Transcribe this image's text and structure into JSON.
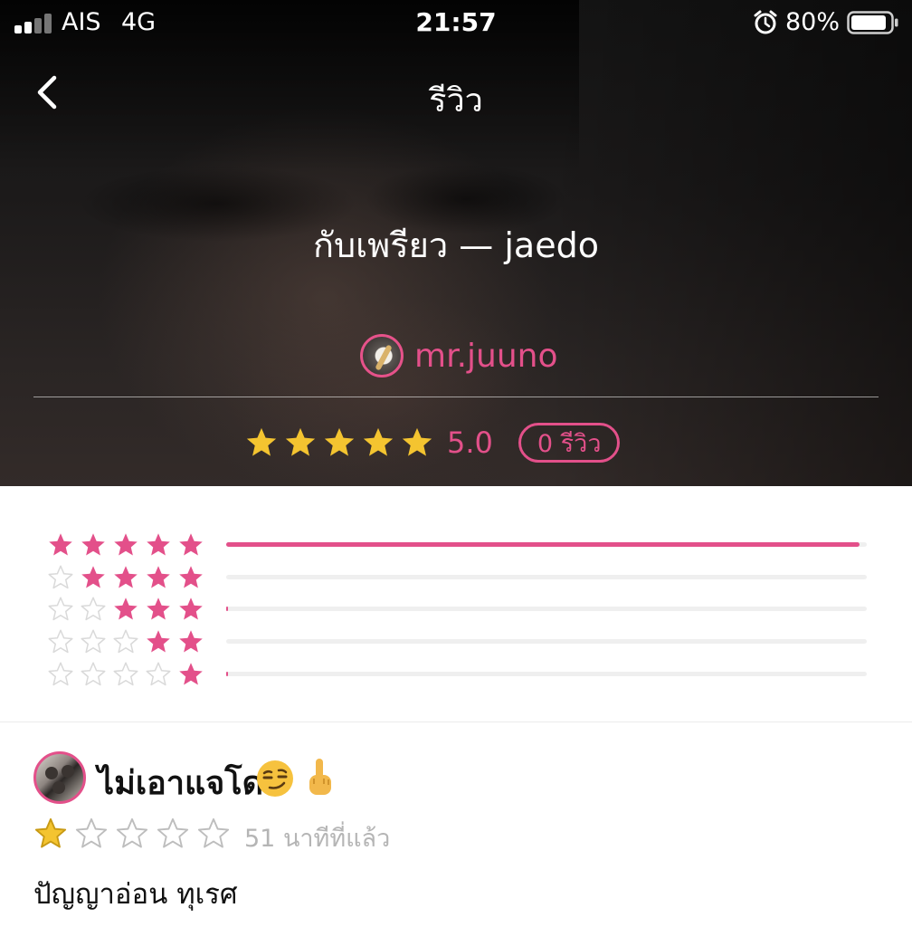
{
  "status_bar": {
    "carrier": "AIS",
    "network": "4G",
    "time": "21:57",
    "battery": "80%",
    "icons": [
      "signal-icon",
      "alarm-icon",
      "battery-icon"
    ]
  },
  "nav": {
    "back_icon": "chevron-left-icon",
    "title": "รีวิว"
  },
  "story": {
    "title": "กับเพรียว — jaedo",
    "author": "mr.juuno"
  },
  "summary": {
    "stars": 5,
    "score": "5.0",
    "review_count_label": "0 รีวิว"
  },
  "distribution": [
    {
      "stars": 5,
      "fraction": 1.0
    },
    {
      "stars": 4,
      "fraction": 0
    },
    {
      "stars": 3,
      "fraction": 0.003
    },
    {
      "stars": 2,
      "fraction": 0
    },
    {
      "stars": 1,
      "fraction": 0.003
    }
  ],
  "reviews": [
    {
      "name": "ไม่เอาแจโด",
      "emojis": [
        "smirk-emoji",
        "middle-finger-emoji"
      ],
      "rating": 1,
      "time": "51 นาทีที่แล้ว",
      "text": "ปัญญาอ่อน ทุเรศ"
    }
  ],
  "colors": {
    "accent": "#e3508a",
    "star_gold": "#f4c430",
    "star_empty": "#d9d9d9"
  }
}
